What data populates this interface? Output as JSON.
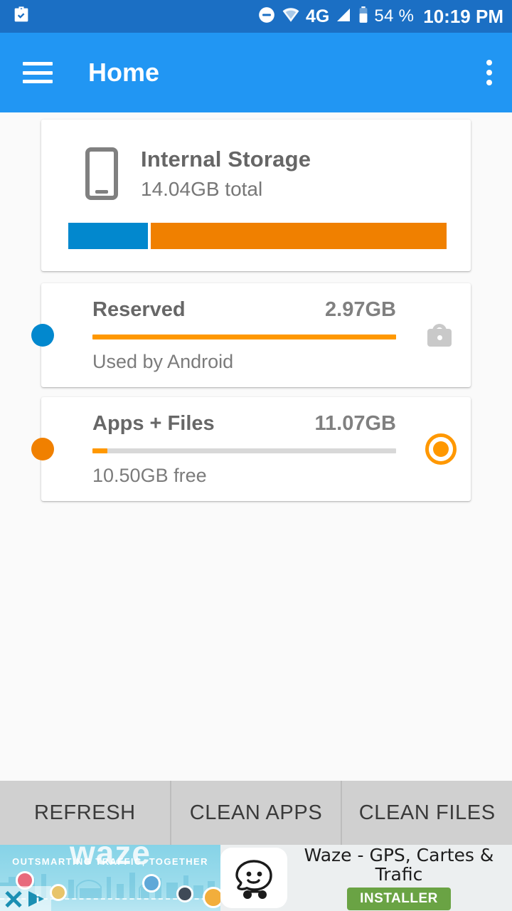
{
  "statusbar": {
    "left_icon": "briefcase-check-icon",
    "dnd_icon": "do-not-disturb-icon",
    "wifi_icon": "wifi-icon",
    "network_label": "4G",
    "signal_icon": "signal-bars-icon",
    "battery_icon": "battery-icon",
    "battery_text": "54 %",
    "time": "10:19 PM",
    "bg_color": "#1b6fc4"
  },
  "appbar": {
    "menu_icon": "hamburger-menu-icon",
    "title": "Home",
    "overflow_icon": "overflow-menu-icon",
    "bg_color": "#2196f3"
  },
  "storage": {
    "icon": "smartphone-icon",
    "title": "Internal Storage",
    "subtitle": "14.04GB total",
    "total_gb": 14.04,
    "segments": [
      {
        "name": "Reserved",
        "color": "#0288ce",
        "percent": 21
      },
      {
        "name": "Apps + Files",
        "color": "#f08000",
        "percent": 78
      }
    ]
  },
  "rows": [
    {
      "dot_color": "#0288ce",
      "title": "Reserved",
      "size": "2.97GB",
      "subtitle": "Used by Android",
      "bar_percent": 100,
      "bar_color": "#ff9800",
      "action_icon": "lock-icon"
    },
    {
      "dot_color": "#f08000",
      "title": "Apps + Files",
      "size": "11.07GB",
      "subtitle": "10.50GB free",
      "bar_percent": 5,
      "bar_color": "#ff9800",
      "action_icon": "radio-selected-icon"
    }
  ],
  "buttons": {
    "refresh": "REFRESH",
    "clean_apps": "CLEAN APPS",
    "clean_files": "CLEAN FILES"
  },
  "ad": {
    "wordmark": "waze",
    "tagline": "OUTSMARTING TRAFFIC, TOGETHER",
    "app_icon": "waze-ghost-icon",
    "title": "Waze - GPS, Cartes & Trafic",
    "cta": "INSTALLER",
    "cta_color": "#6aa344",
    "close_icon": "close-icon",
    "adchoices_icon": "adchoices-icon"
  }
}
